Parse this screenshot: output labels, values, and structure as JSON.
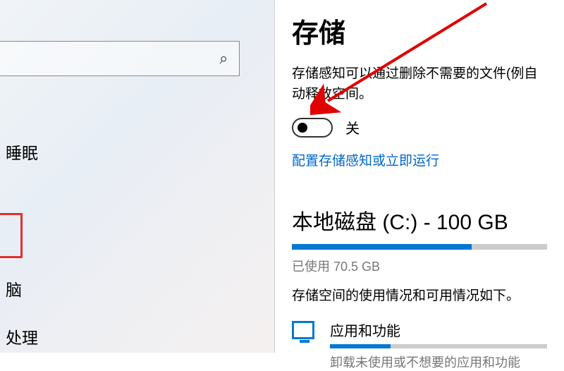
{
  "sidebar": {
    "nav": {
      "sleep": "睡眠",
      "pc": "脑",
      "proc": "处理"
    }
  },
  "main": {
    "title": "存储",
    "storage_sense_desc": "存储感知可以通过删除不需要的文件(例自动释放空间。",
    "toggle_state": "关",
    "config_link": "配置存储感知或立即运行",
    "disk": {
      "title": "本地磁盘 (C:) - 100 GB",
      "used_label": "已使用",
      "used_value": "70.5 GB"
    },
    "usage_desc": "存储空间的使用情况和可用情况如下。",
    "apps": {
      "title": "应用和功能",
      "sub": "卸载未使用或不想要的应用和功能"
    }
  }
}
